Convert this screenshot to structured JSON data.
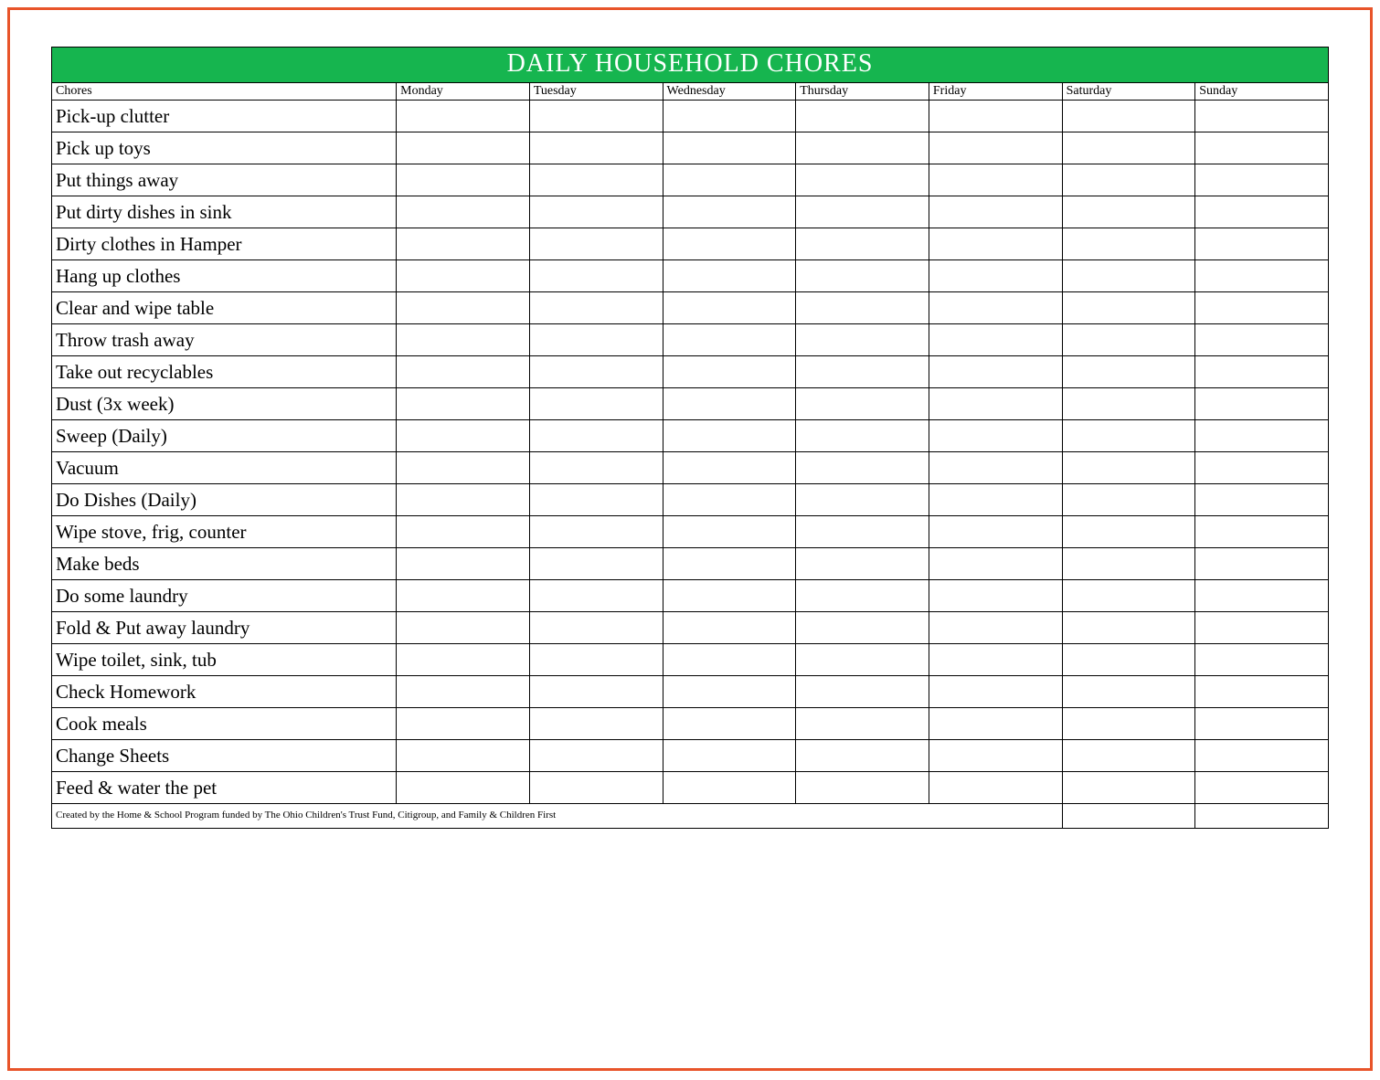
{
  "title": "DAILY HOUSEHOLD CHORES",
  "header": {
    "chore_label": "Chores",
    "days": [
      "Monday",
      "Tuesday",
      "Wednesday",
      "Thursday",
      "Friday",
      "Saturday",
      "Sunday"
    ]
  },
  "chores": [
    "Pick-up clutter",
    "Pick up toys",
    "Put things away",
    "Put dirty dishes in sink",
    "Dirty clothes in Hamper",
    "Hang up clothes",
    "Clear and wipe table",
    "Throw trash away",
    "Take out recyclables",
    "Dust (3x week)",
    "Sweep (Daily)",
    "Vacuum",
    "Do Dishes (Daily)",
    "Wipe stove, frig, counter",
    "Make beds",
    "Do some laundry",
    "Fold & Put away laundry",
    "Wipe toilet, sink, tub",
    "Check Homework",
    "Cook meals",
    "Change Sheets",
    "Feed & water the pet"
  ],
  "footer": "Created by the Home & School Program funded by The Ohio Children's Trust Fund, Citigroup, and Family & Children First"
}
